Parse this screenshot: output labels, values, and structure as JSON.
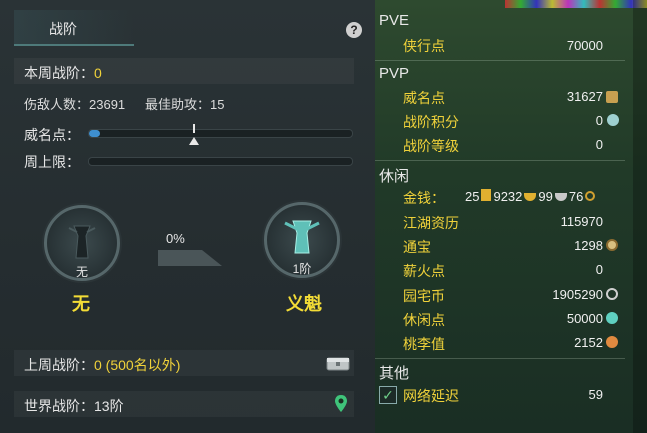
{
  "left": {
    "tab_label": "战阶",
    "help_label": "?",
    "weekly_rank_label": "本周战阶：",
    "weekly_rank_value": "0",
    "kills_label": "伤敌人数：",
    "kills_value": "23691",
    "assist_label": "最佳助攻：",
    "assist_value": "15",
    "renown_label": "威名点：",
    "weekly_cap_label": "周上限：",
    "renown_progress": 0.04,
    "progress_pct": "0%",
    "current_rank_level": "无",
    "current_rank_name": "无",
    "next_rank_level": "1阶",
    "next_rank_name": "义魁",
    "last_week_label": "上周战阶：",
    "last_week_value": "0 (500名以外)",
    "world_rank_label": "世界战阶：",
    "world_rank_value": "13阶"
  },
  "right": {
    "pve": {
      "title": "PVE",
      "items": [
        {
          "label": "侠行点",
          "value": "70000"
        }
      ]
    },
    "pvp": {
      "title": "PVP",
      "items": [
        {
          "label": "威名点",
          "value": "31627"
        },
        {
          "label": "战阶积分",
          "value": "0"
        },
        {
          "label": "战阶等级",
          "value": "0"
        }
      ]
    },
    "leisure": {
      "title": "休闲",
      "money_label": "金钱：",
      "money_a": "25",
      "money_b": "9232",
      "money_c": "99",
      "money_d": "76",
      "items": [
        {
          "label": "江湖资历",
          "value": "115970"
        },
        {
          "label": "通宝",
          "value": "1298"
        },
        {
          "label": "薪火点",
          "value": "0"
        },
        {
          "label": "园宅币",
          "value": "1905290"
        },
        {
          "label": "休闲点",
          "value": "50000"
        },
        {
          "label": "桃李值",
          "value": "2152"
        }
      ]
    },
    "other": {
      "title": "其他",
      "latency_label": "网络延迟",
      "latency_value": "59"
    }
  },
  "colors": {
    "gold": "#f0d23a",
    "progress": "#3e8fd0"
  }
}
